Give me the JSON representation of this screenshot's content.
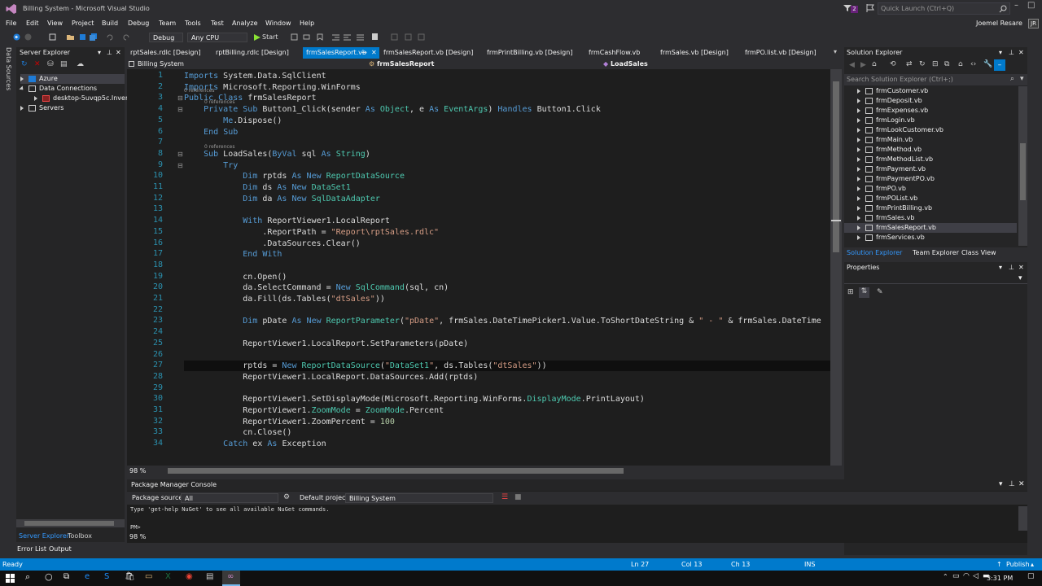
{
  "window": {
    "title": "Billing System - Microsoft Visual Studio",
    "quick_launch": "Quick Launch (Ctrl+Q)",
    "notifications": "2",
    "user_name": "Joemel Resare",
    "user_initials": "JR"
  },
  "menu": [
    "File",
    "Edit",
    "View",
    "Project",
    "Build",
    "Debug",
    "Team",
    "Tools",
    "Test",
    "Analyze",
    "Window",
    "Help"
  ],
  "toolbar": {
    "config": "Debug",
    "platform": "Any CPU",
    "start_label": "Start"
  },
  "left_rail": {
    "label": "Data Sources"
  },
  "server_explorer": {
    "title": "Server Explorer",
    "items": [
      {
        "label": "Azure"
      },
      {
        "label": "Data Connections"
      },
      {
        "label": "desktop-5uvqp5c.Invent"
      },
      {
        "label": "Servers"
      }
    ],
    "tab_server": "Server Explorer",
    "tab_toolbox": "Toolbox"
  },
  "editor_tabs": [
    {
      "label": "rptSales.rdlc [Design]"
    },
    {
      "label": "rptBilling.rdlc [Design]"
    },
    {
      "label": "frmSalesReport.vb"
    },
    {
      "label": "frmSalesReport.vb [Design]"
    },
    {
      "label": "frmPrintBilling.vb [Design]"
    },
    {
      "label": "frmCashFlow.vb"
    },
    {
      "label": "frmSales.vb [Design]"
    },
    {
      "label": "frmPO.list.vb [Design]"
    }
  ],
  "navbar": {
    "project": "Billing System",
    "class": "frmSalesReport",
    "member": "LoadSales"
  },
  "editor": {
    "zoom": "98 %",
    "references_label": "0 references",
    "lines": [
      {
        "n": "1",
        "text": "Imports System.Data.SqlClient"
      },
      {
        "n": "2",
        "text": "Imports Microsoft.Reporting.WinForms"
      },
      {
        "n": "3",
        "text": "Public Class frmSalesReport"
      },
      {
        "n": "4",
        "text": "    Private Sub Button1_Click(sender As Object, e As EventArgs) Handles Button1.Click"
      },
      {
        "n": "5",
        "text": "        Me.Dispose()"
      },
      {
        "n": "6",
        "text": "    End Sub"
      },
      {
        "n": "7",
        "text": ""
      },
      {
        "n": "8",
        "text": "    Sub LoadSales(ByVal sql As String)"
      },
      {
        "n": "9",
        "text": "        Try"
      },
      {
        "n": "10",
        "text": "            Dim rptds As New ReportDataSource"
      },
      {
        "n": "11",
        "text": "            Dim ds As New DataSet1"
      },
      {
        "n": "12",
        "text": "            Dim da As New SqlDataAdapter"
      },
      {
        "n": "13",
        "text": ""
      },
      {
        "n": "14",
        "text": "            With ReportViewer1.LocalReport"
      },
      {
        "n": "15",
        "text": "                .ReportPath = \"Report\\rptSales.rdlc\""
      },
      {
        "n": "16",
        "text": "                .DataSources.Clear()"
      },
      {
        "n": "17",
        "text": "            End With"
      },
      {
        "n": "18",
        "text": ""
      },
      {
        "n": "19",
        "text": "            cn.Open()"
      },
      {
        "n": "20",
        "text": "            da.SelectCommand = New SqlCommand(sql, cn)"
      },
      {
        "n": "21",
        "text": "            da.Fill(ds.Tables(\"dtSales\"))"
      },
      {
        "n": "22",
        "text": ""
      },
      {
        "n": "23",
        "text": "            Dim pDate As New ReportParameter(\"pDate\", frmSales.DateTimePicker1.Value.ToShortDateString & \" - \" & frmSales.DateTime"
      },
      {
        "n": "24",
        "text": ""
      },
      {
        "n": "25",
        "text": "            ReportViewer1.LocalReport.SetParameters(pDate)"
      },
      {
        "n": "26",
        "text": ""
      },
      {
        "n": "27",
        "text": "            rptds = New ReportDataSource(\"DataSet1\", ds.Tables(\"dtSales\"))"
      },
      {
        "n": "28",
        "text": "            ReportViewer1.LocalReport.DataSources.Add(rptds)"
      },
      {
        "n": "29",
        "text": ""
      },
      {
        "n": "30",
        "text": "            ReportViewer1.SetDisplayMode(Microsoft.Reporting.WinForms.DisplayMode.PrintLayout)"
      },
      {
        "n": "31",
        "text": "            ReportViewer1.ZoomMode = ZoomMode.Percent"
      },
      {
        "n": "32",
        "text": "            ReportViewer1.ZoomPercent = 100"
      },
      {
        "n": "33",
        "text": "            cn.Close()"
      },
      {
        "n": "34",
        "text": "        Catch ex As Exception"
      }
    ]
  },
  "solution_explorer": {
    "title": "Solution Explorer",
    "search_placeholder": "Search Solution Explorer (Ctrl+;)",
    "files": [
      "frmCustomer.vb",
      "frmDeposit.vb",
      "frmExpenses.vb",
      "frmLogin.vb",
      "frmLookCustomer.vb",
      "frmMain.vb",
      "frmMethod.vb",
      "frmMethodList.vb",
      "frmPayment.vb",
      "frmPaymentPO.vb",
      "frmPO.vb",
      "frmPOList.vb",
      "frmPrintBilling.vb",
      "frmSales.vb",
      "frmSalesReport.vb",
      "frmServices.vb"
    ],
    "selected": "frmSalesReport.vb",
    "tabs": [
      "Solution Explorer",
      "Team Explorer",
      "Class View"
    ]
  },
  "properties": {
    "title": "Properties"
  },
  "package_manager": {
    "title": "Package Manager Console",
    "source_label": "Package source:",
    "source_value": "All",
    "project_label": "Default project:",
    "project_value": "Billing System",
    "message": "Type 'get-help NuGet' to see all available NuGet commands.",
    "prompt": "PM>",
    "zoom": "98 %"
  },
  "bottom_tabs": [
    "Error List",
    "Output"
  ],
  "status": {
    "ready": "Ready",
    "line": "Ln 27",
    "col": "Col 13",
    "ch": "Ch 13",
    "mode": "INS",
    "publish": "Publish"
  },
  "taskbar": {
    "time": "3:31 PM"
  }
}
